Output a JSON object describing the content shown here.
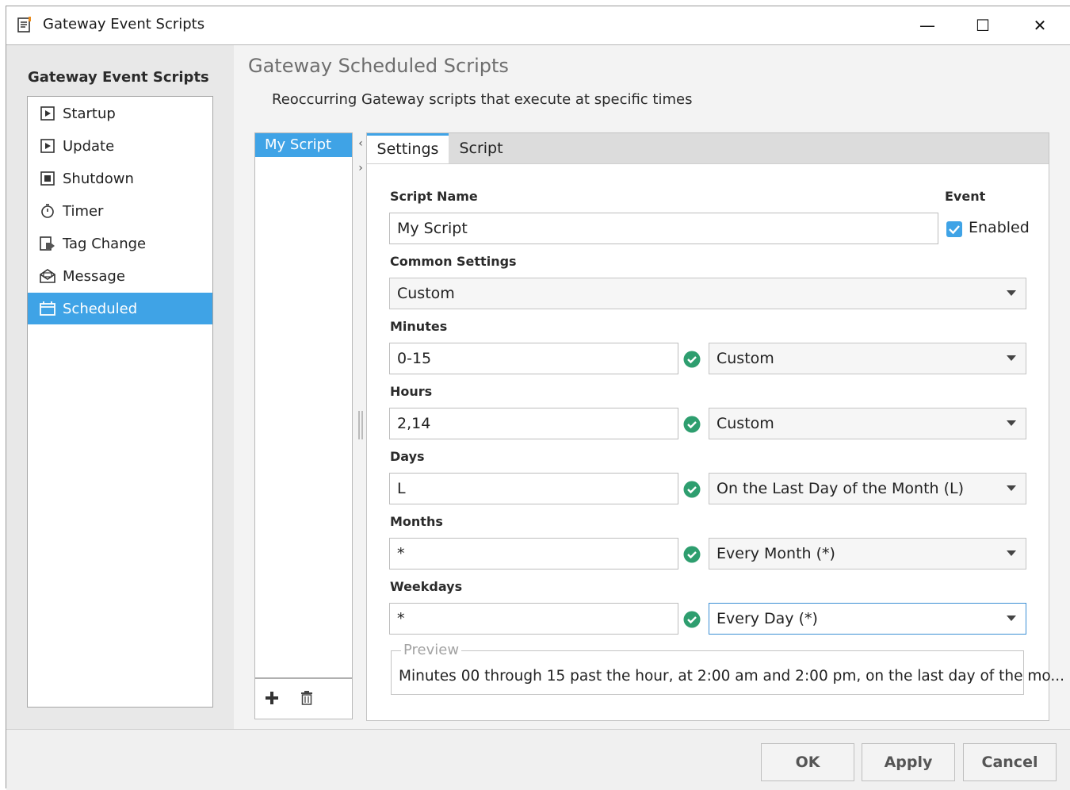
{
  "window": {
    "title": "Gateway Event Scripts",
    "minimize_glyph": "—",
    "maximize_glyph": "☐",
    "close_glyph": "✕"
  },
  "sidebar": {
    "title": "Gateway Event Scripts",
    "items": [
      {
        "label": "Startup",
        "icon": "play-page-icon"
      },
      {
        "label": "Update",
        "icon": "play-page-icon"
      },
      {
        "label": "Shutdown",
        "icon": "stop-page-icon"
      },
      {
        "label": "Timer",
        "icon": "stopwatch-icon"
      },
      {
        "label": "Tag Change",
        "icon": "tag-change-icon"
      },
      {
        "label": "Message",
        "icon": "envelope-icon"
      },
      {
        "label": "Scheduled",
        "icon": "calendar-icon",
        "selected": true
      }
    ]
  },
  "main": {
    "title": "Gateway Scheduled Scripts",
    "description": "Reoccurring Gateway scripts that execute at specific times"
  },
  "script_list": {
    "items": [
      "My Script"
    ],
    "collapse_left_glyph": "‹",
    "collapse_right_glyph": "›"
  },
  "tabs": [
    {
      "label": "Settings",
      "active": true
    },
    {
      "label": "Script",
      "active": false
    }
  ],
  "settings": {
    "script_name_label": "Script Name",
    "script_name_value": "My Script",
    "event_label": "Event",
    "enabled_label": "Enabled",
    "enabled_checked": true,
    "common_settings_label": "Common Settings",
    "common_settings_value": "Custom",
    "minutes_label": "Minutes",
    "minutes_value": "0-15",
    "minutes_preset": "Custom",
    "hours_label": "Hours",
    "hours_value": "2,14",
    "hours_preset": "Custom",
    "days_label": "Days",
    "days_value": "L",
    "days_preset": "On the Last Day of the Month (L)",
    "months_label": "Months",
    "months_value": "*",
    "months_preset": "Every Month (*)",
    "weekdays_label": "Weekdays",
    "weekdays_value": "*",
    "weekdays_preset": "Every Day (*)",
    "preview_label": "Preview",
    "preview_text": "Minutes 00 through 15 past the hour, at 2:00 am and 2:00 pm, on the last day of the mo..."
  },
  "buttons": {
    "ok": "OK",
    "apply": "Apply",
    "cancel": "Cancel"
  },
  "colors": {
    "accent": "#3fa3e6",
    "valid": "#2e9e6f"
  }
}
